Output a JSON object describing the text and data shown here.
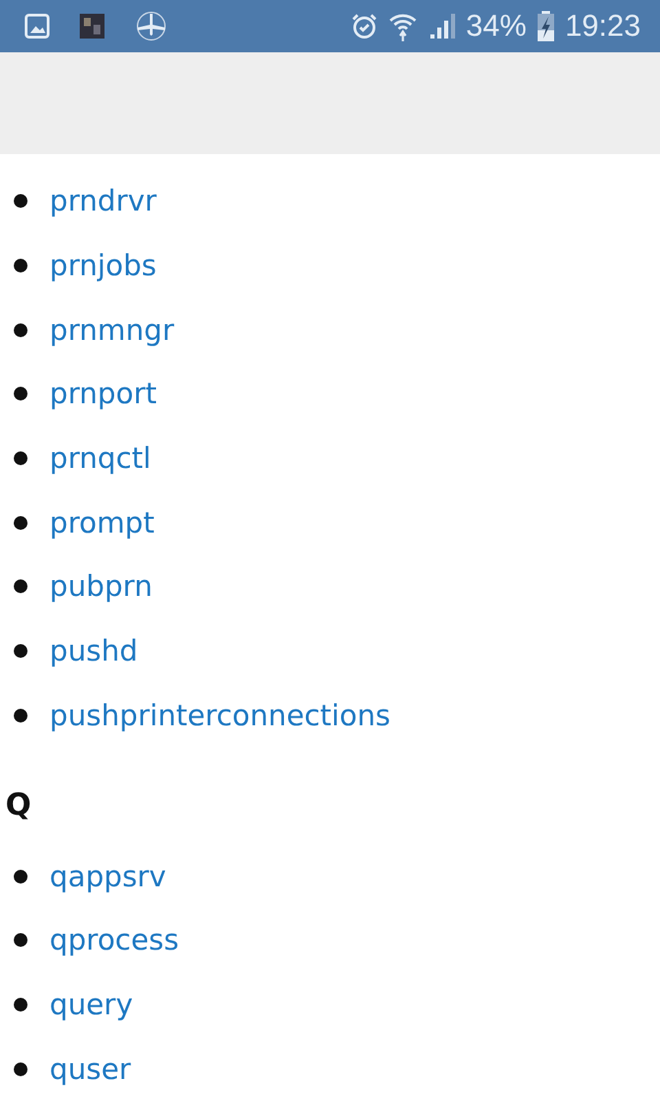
{
  "status_bar": {
    "battery": "34%",
    "time": "19:23"
  },
  "sections": [
    {
      "items": [
        "prndrvr",
        "prnjobs",
        "prnmngr",
        "prnport",
        "prnqctl",
        "prompt",
        "pubprn",
        "pushd",
        "pushprinterconnections"
      ]
    },
    {
      "heading": "Q",
      "items": [
        "qappsrv",
        "qprocess",
        "query",
        "quser"
      ]
    }
  ]
}
